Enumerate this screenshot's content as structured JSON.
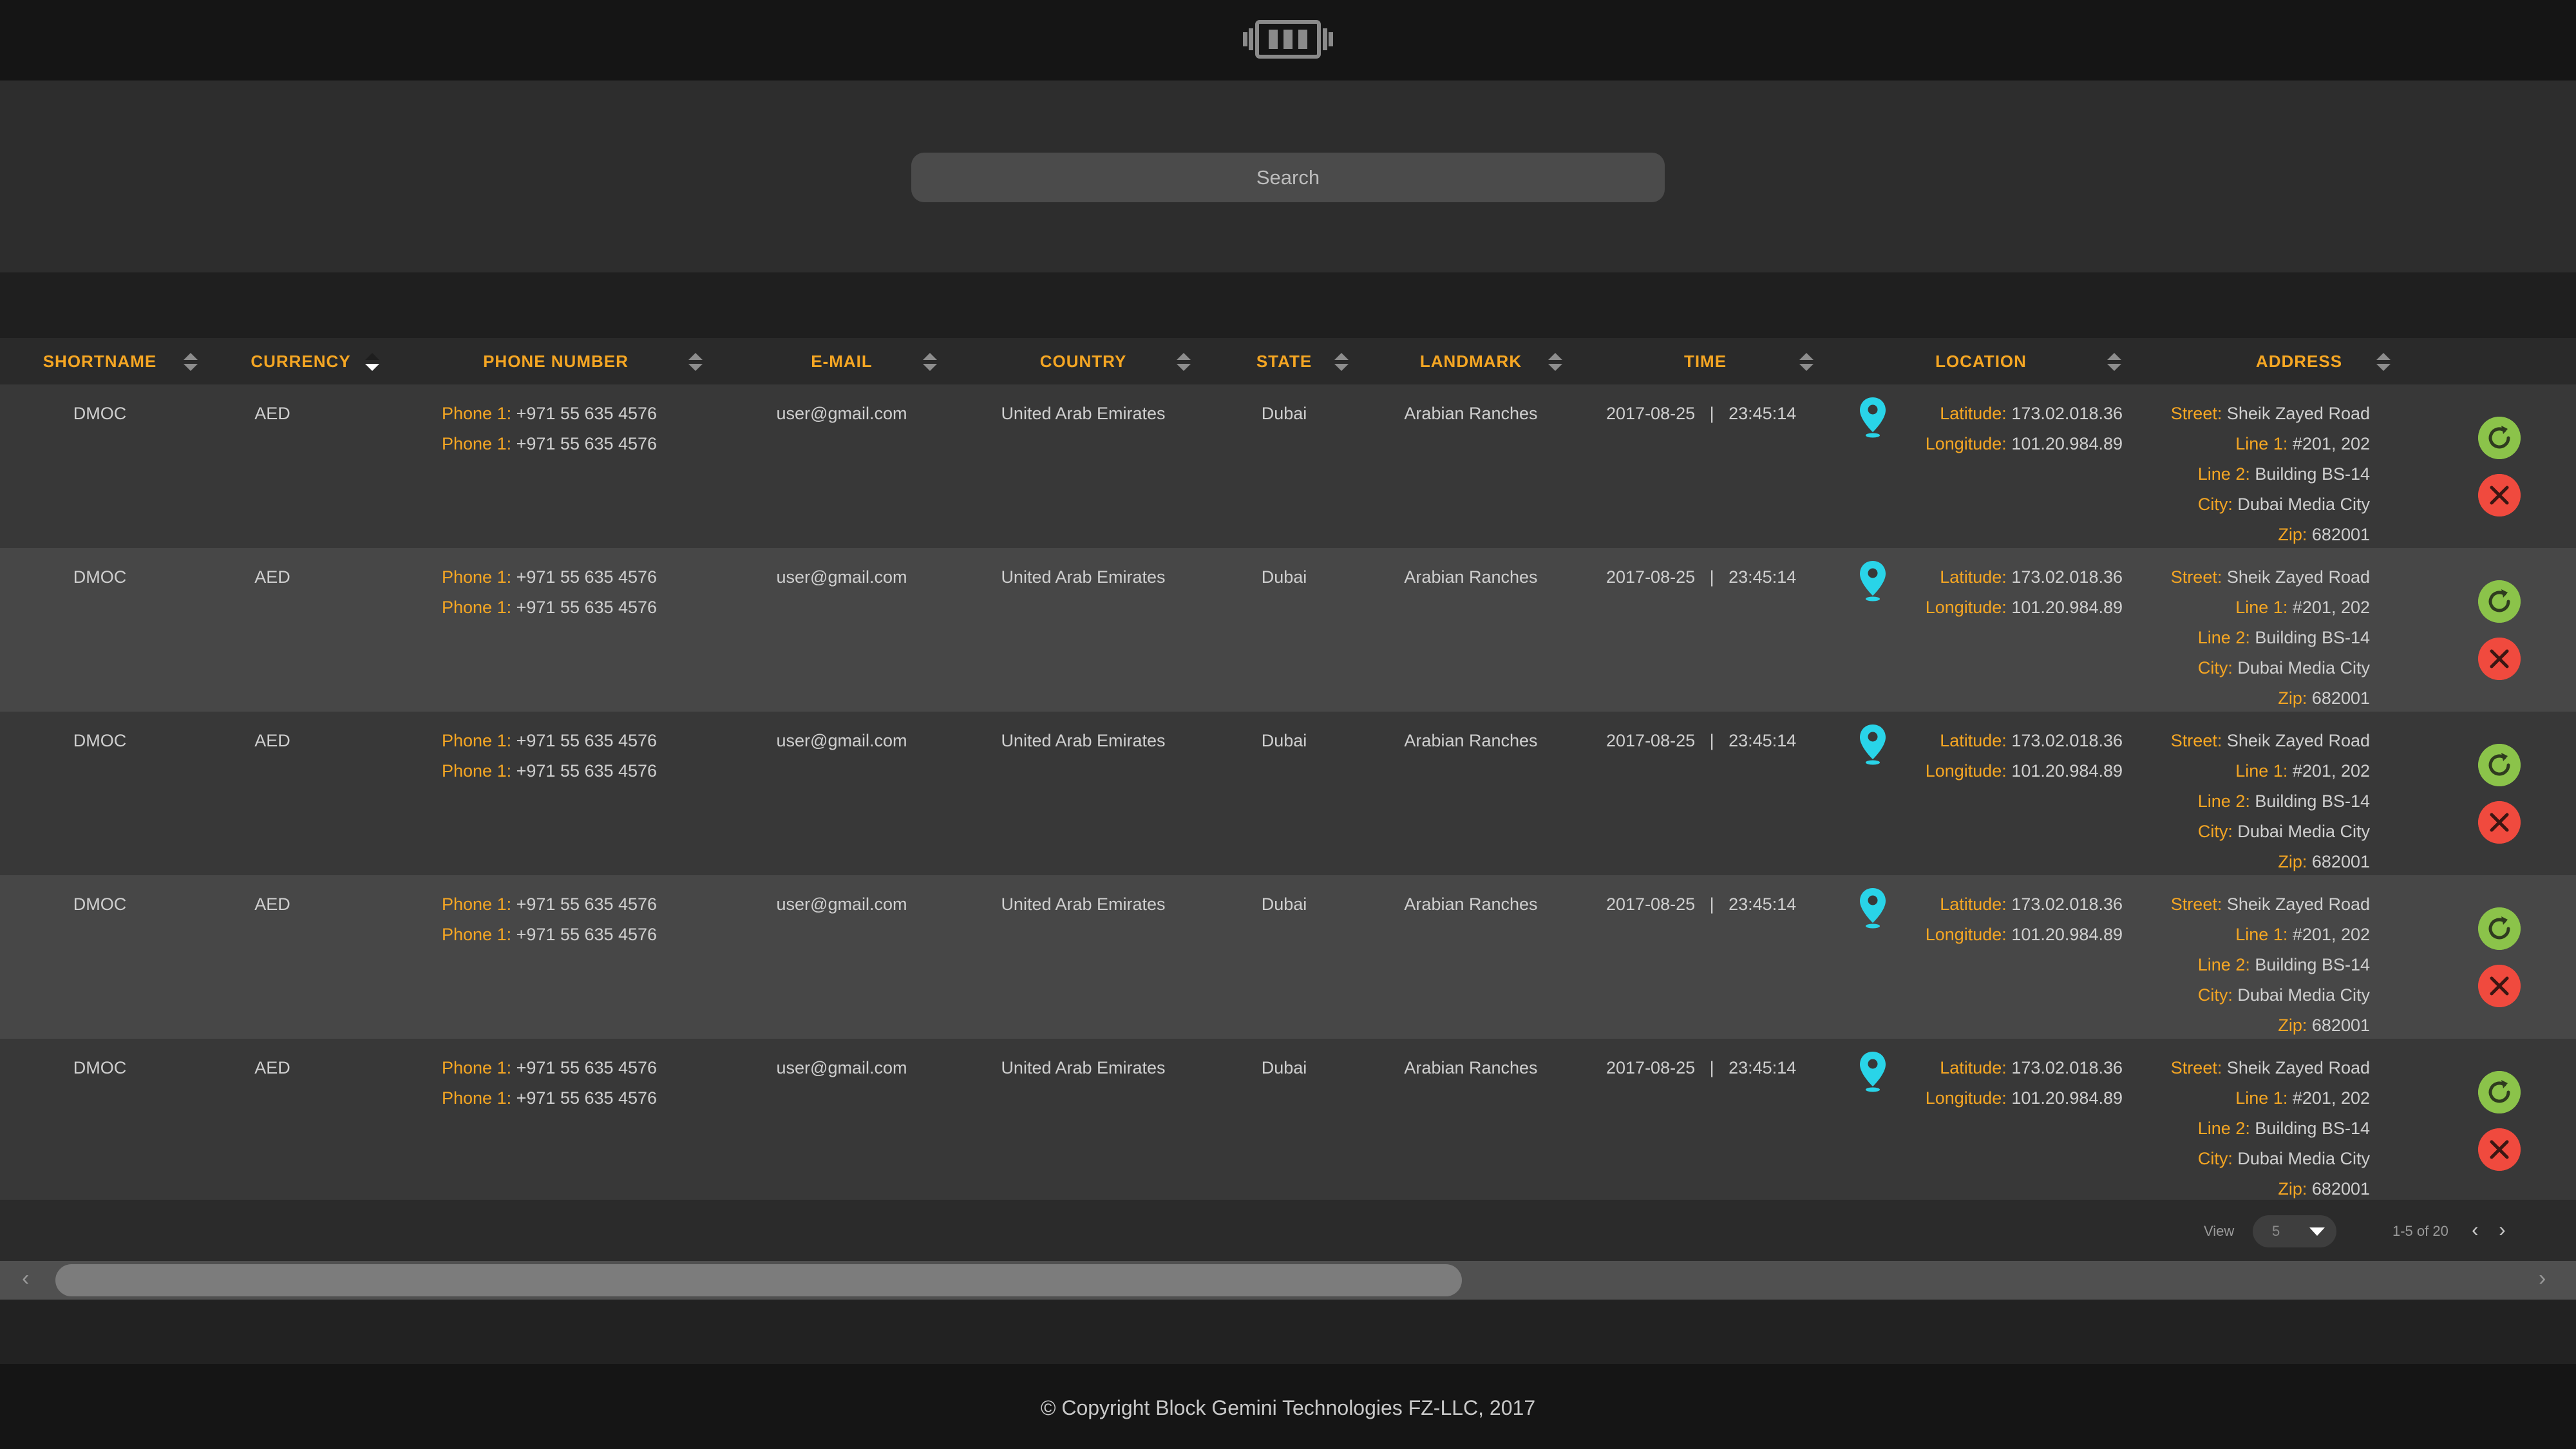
{
  "search": {
    "placeholder": "Search"
  },
  "table": {
    "columns": [
      {
        "key": "shortname",
        "label": "SHORTNAME"
      },
      {
        "key": "currency",
        "label": "CURRENCY",
        "sort": "descending"
      },
      {
        "key": "phone",
        "label": "PHONE NUMBER"
      },
      {
        "key": "email",
        "label": "E-MAIL"
      },
      {
        "key": "country",
        "label": "COUNTRY"
      },
      {
        "key": "state",
        "label": "STATE"
      },
      {
        "key": "landmark",
        "label": "LANDMARK"
      },
      {
        "key": "time",
        "label": "TIME"
      },
      {
        "key": "location",
        "label": "LOCATION"
      },
      {
        "key": "address",
        "label": "ADDRESS"
      }
    ],
    "labels": {
      "phone": "Phone 1:",
      "latitude": "Latitude:",
      "longitude": "Longitude:",
      "street": "Street:",
      "line1": "Line 1:",
      "line2": "Line 2:",
      "city": "City:",
      "zip": "Zip:"
    },
    "rows": [
      {
        "shortname": "DMOC",
        "currency": "AED",
        "phone1": "+971 55 635 4576",
        "phone2": "+971 55 635 4576",
        "email": "user@gmail.com",
        "country": "United Arab Emirates",
        "state": "Dubai",
        "landmark": "Arabian Ranches",
        "time": "2017-08-25   |   23:45:14",
        "latitude": "173.02.018.36",
        "longitude": "101.20.984.89",
        "street": "Sheik Zayed Road",
        "line1": "#201, 202",
        "line2": "Building BS-14",
        "city": "Dubai Media City",
        "zip": "682001"
      },
      {
        "shortname": "DMOC",
        "currency": "AED",
        "phone1": "+971 55 635 4576",
        "phone2": "+971 55 635 4576",
        "email": "user@gmail.com",
        "country": "United Arab Emirates",
        "state": "Dubai",
        "landmark": "Arabian Ranches",
        "time": "2017-08-25   |   23:45:14",
        "latitude": "173.02.018.36",
        "longitude": "101.20.984.89",
        "street": "Sheik Zayed Road",
        "line1": "#201, 202",
        "line2": "Building BS-14",
        "city": "Dubai Media City",
        "zip": "682001"
      },
      {
        "shortname": "DMOC",
        "currency": "AED",
        "phone1": "+971 55 635 4576",
        "phone2": "+971 55 635 4576",
        "email": "user@gmail.com",
        "country": "United Arab Emirates",
        "state": "Dubai",
        "landmark": "Arabian Ranches",
        "time": "2017-08-25   |   23:45:14",
        "latitude": "173.02.018.36",
        "longitude": "101.20.984.89",
        "street": "Sheik Zayed Road",
        "line1": "#201, 202",
        "line2": "Building BS-14",
        "city": "Dubai Media City",
        "zip": "682001"
      },
      {
        "shortname": "DMOC",
        "currency": "AED",
        "phone1": "+971 55 635 4576",
        "phone2": "+971 55 635 4576",
        "email": "user@gmail.com",
        "country": "United Arab Emirates",
        "state": "Dubai",
        "landmark": "Arabian Ranches",
        "time": "2017-08-25   |   23:45:14",
        "latitude": "173.02.018.36",
        "longitude": "101.20.984.89",
        "street": "Sheik Zayed Road",
        "line1": "#201, 202",
        "line2": "Building BS-14",
        "city": "Dubai Media City",
        "zip": "682001"
      },
      {
        "shortname": "DMOC",
        "currency": "AED",
        "phone1": "+971 55 635 4576",
        "phone2": "+971 55 635 4576",
        "email": "user@gmail.com",
        "country": "United Arab Emirates",
        "state": "Dubai",
        "landmark": "Arabian Ranches",
        "time": "2017-08-25   |   23:45:14",
        "latitude": "173.02.018.36",
        "longitude": "101.20.984.89",
        "street": "Sheik Zayed Road",
        "line1": "#201, 202",
        "line2": "Building BS-14",
        "city": "Dubai Media City",
        "zip": "682001"
      }
    ]
  },
  "pagination": {
    "view_label": "View",
    "page_size": "5",
    "range": "1-5 of 20",
    "prev_icon": "chevron-left-icon",
    "next_icon": "chevron-right-icon"
  },
  "icons": {
    "logo": "block-gemini-logo",
    "location": "map-pin-icon",
    "refresh": "refresh-icon",
    "delete": "close-icon",
    "sort": "sort-arrows-icon"
  },
  "colors": {
    "accent": "#f5a623",
    "pin": "#29d4e8",
    "ok": "#8bc34a",
    "delete": "#f04a3e"
  },
  "footer": {
    "copyright": "© Copyright Block Gemini Technologies FZ-LLC, 2017"
  }
}
